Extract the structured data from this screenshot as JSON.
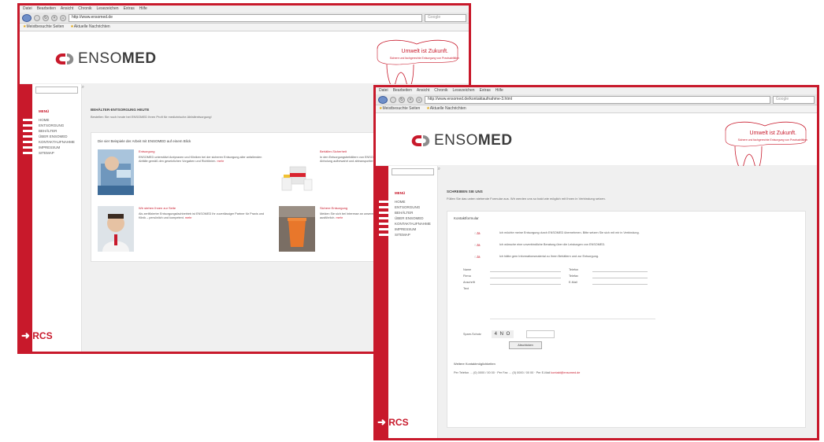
{
  "browser": {
    "menu": [
      "Datei",
      "Bearbeiten",
      "Ansicht",
      "Chronik",
      "Lesezeichen",
      "Extras",
      "Hilfe"
    ],
    "search_placeholder": "Google",
    "bookmarks": [
      "Meistbesuchte Seiten",
      "Aktuelle Nachrichten"
    ]
  },
  "window1": {
    "url": "http://www.ensomed.de"
  },
  "window2": {
    "url": "http://www.ensomed.de/kontaktaufnahme-3.html"
  },
  "site": {
    "logo_prefix": "ENSO",
    "logo_bold": "MED",
    "tagline_title": "Umwelt ist Zukunft.",
    "tagline_sub": "Sichere und fachgerechte Entsorgung von Praxisabfällen",
    "menu_head": "MENÜ",
    "menu": [
      "HOME",
      "ENTSORGUNG",
      "BEHÄLTER",
      "ÜBER ENSOMED",
      "KONTAKTAUFNAHME",
      "IMPRESSUM",
      "SITEMAP"
    ],
    "partner_logo": "RCS"
  },
  "home": {
    "title": "BEHÄLTER-ENTSORGUNG HEUTE",
    "intro": "Bestellen Sie noch heute bei ENSOMED Ihren Profi für medizinische Abfallentsorgung!",
    "panel_title": "Die vier Beispiele der Arbeit mit ENSOMED auf einem Blick",
    "cards": [
      {
        "title": "Entsorgung",
        "text": "ENSOMED unterstützt Arztpraxen und Kliniken bei der sicheren Entsorgung aller anfallenden Abfälle gemäß den gesetzlichen Vorgaben und Richtlinien.",
        "more": "mehr"
      },
      {
        "title": "Behälter-Sicherheit",
        "text": "In den Entsorgungsbehältern von ENSOMED werden alle Abfälle sicher und hygienisch bis zur Abholung aufbewahrt und abtransportiert.",
        "more": "mehr"
      },
      {
        "title": "Wir stehen Ihnen zur Seite",
        "text": "Als zertifizierter Entsorgungsfachbetrieb ist ENSOMED Ihr zuverlässiger Partner für Praxis und Klinik – persönlich und kompetent.",
        "more": "mehr"
      },
      {
        "title": "Sichere Entsorgung",
        "text": "Melden Sie sich bei Interesse an unseren Leistungen – unsere Mitarbeiter beraten Sie gerne ausführlich.",
        "more": "mehr"
      }
    ]
  },
  "contact": {
    "title": "SCHREIBEN SIE UNS",
    "intro": "Füllen Sie das unten stehende Formular aus. Wir werden uns so bald wie möglich mit Ihnen in Verbindung setzen.",
    "panel_head": "Kontaktformular",
    "options": [
      {
        "label": "Ja",
        "text": "Ich möchte meine Entsorgung durch ENSOMED übernehmen. Bitte setzen Sie sich mit mir in Verbindung."
      },
      {
        "label": "Ja",
        "text": "Ich wünsche eine unverbindliche Beratung über die Leistungen von ENSOMED."
      },
      {
        "label": "Ja",
        "text": "Ich hätte gern Informationsmaterial zu Ihren Behältern und zur Entsorgung."
      }
    ],
    "fields": [
      {
        "label": "Name",
        "label2": "Telefon"
      },
      {
        "label": "Firma",
        "label2": "Telefax"
      },
      {
        "label": "Anschrift",
        "label2": "E-Mail"
      }
    ],
    "text_label": "Text",
    "captcha_label": "Spam-Schutz",
    "captcha_code": "4 N O",
    "submit": "Abschicken",
    "alt_title": "Weitere Kontaktmöglichkeiten",
    "alt_line": "Per Telefon … (0) 0000 / 00 00 · Per Fax … (0) 0000 / 00 00 · Per E-Mail",
    "alt_mail": "kontakt@ensomed.de"
  }
}
